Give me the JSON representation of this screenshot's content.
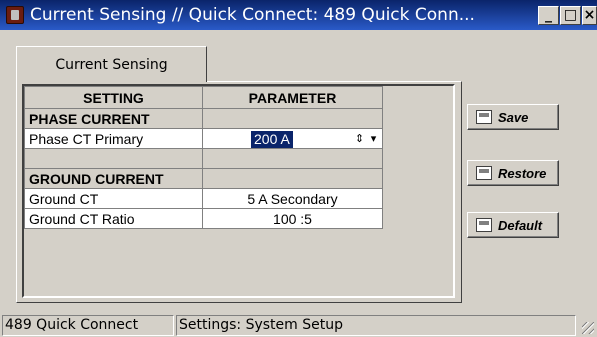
{
  "window": {
    "title": "Current Sensing // Quick Connect: 489 Quick Conn...",
    "min_label": "_",
    "max_label": "□",
    "close_label": "×"
  },
  "tabs": [
    {
      "label": "Current Sensing",
      "active": true
    }
  ],
  "grid": {
    "headers": [
      "SETTING",
      "PARAMETER"
    ],
    "sections": {
      "phase": "PHASE CURRENT",
      "ground": "GROUND CURRENT"
    },
    "rows": {
      "phase_ct_primary": {
        "setting": "Phase CT Primary",
        "value": "200 A"
      },
      "ground_ct": {
        "setting": "Ground CT",
        "value": "5 A Secondary"
      },
      "ground_ct_ratio": {
        "setting": "Ground CT Ratio",
        "value": "100 :5"
      }
    }
  },
  "buttons": {
    "save": "Save",
    "restore": "Restore",
    "default": "Default"
  },
  "statusbar": {
    "device": "489 Quick Connect",
    "info": "Settings: System Setup"
  },
  "colors": {
    "titlebar": "#0a246a",
    "face": "#d4d0c8",
    "selection": "#0a246a"
  }
}
